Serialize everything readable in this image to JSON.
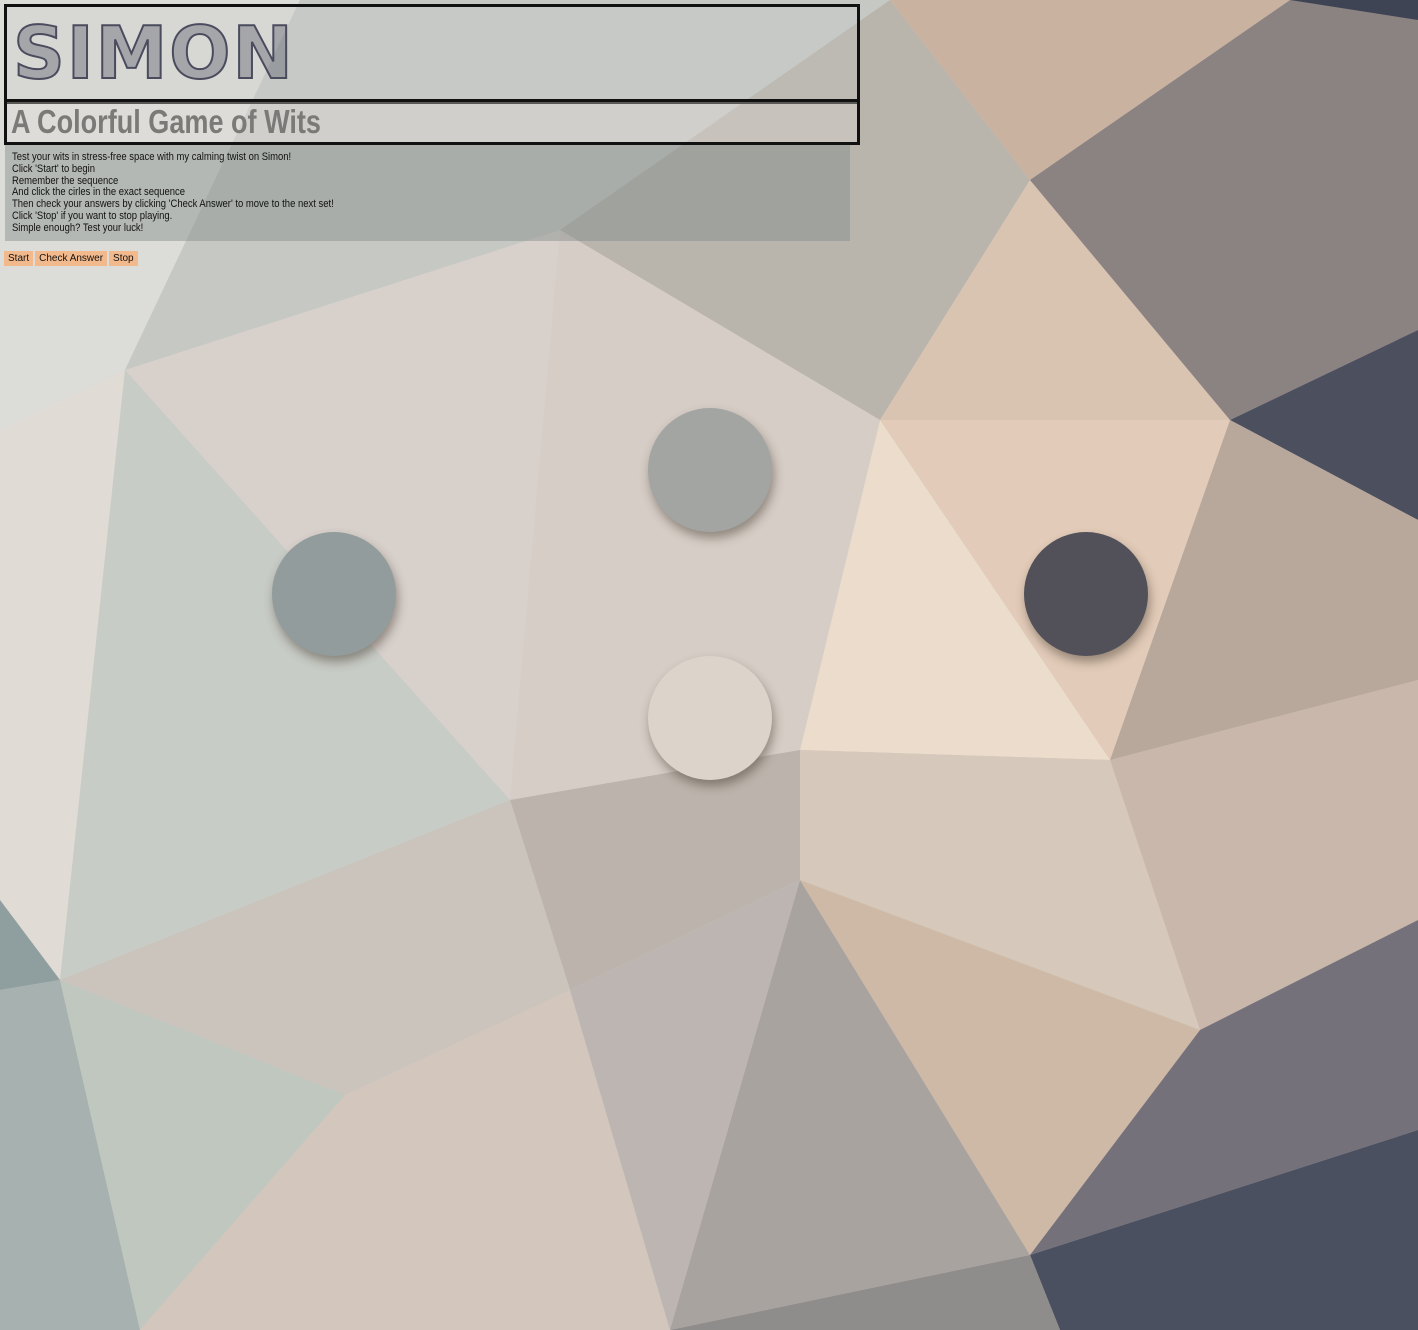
{
  "header": {
    "title": "SIMON",
    "subtitle": "A Colorful Game of Wits"
  },
  "instructions": [
    "Test your wits in stress-free space with my calming twist on Simon!",
    "Click 'Start' to begin",
    "Remember the sequence",
    "And click the cirles in the exact sequence",
    "Then check your answers by clicking 'Check Answer' to move to the next set!",
    "Click 'Stop' if you want to stop playing.",
    "Simple enough? Test your luck!"
  ],
  "controls": {
    "start_label": "Start",
    "check_label": "Check Answer",
    "stop_label": "Stop"
  },
  "game_circles": [
    {
      "position": "top",
      "color": "#a3a5a3"
    },
    {
      "position": "left",
      "color": "#929c9c"
    },
    {
      "position": "right",
      "color": "#52515a"
    },
    {
      "position": "bottom",
      "color": "#dcd3cb"
    }
  ],
  "colors": {
    "button_bg": "#f2b98c",
    "title_stroke": "#4a4c5e",
    "subtitle_text": "#7a7a78"
  }
}
